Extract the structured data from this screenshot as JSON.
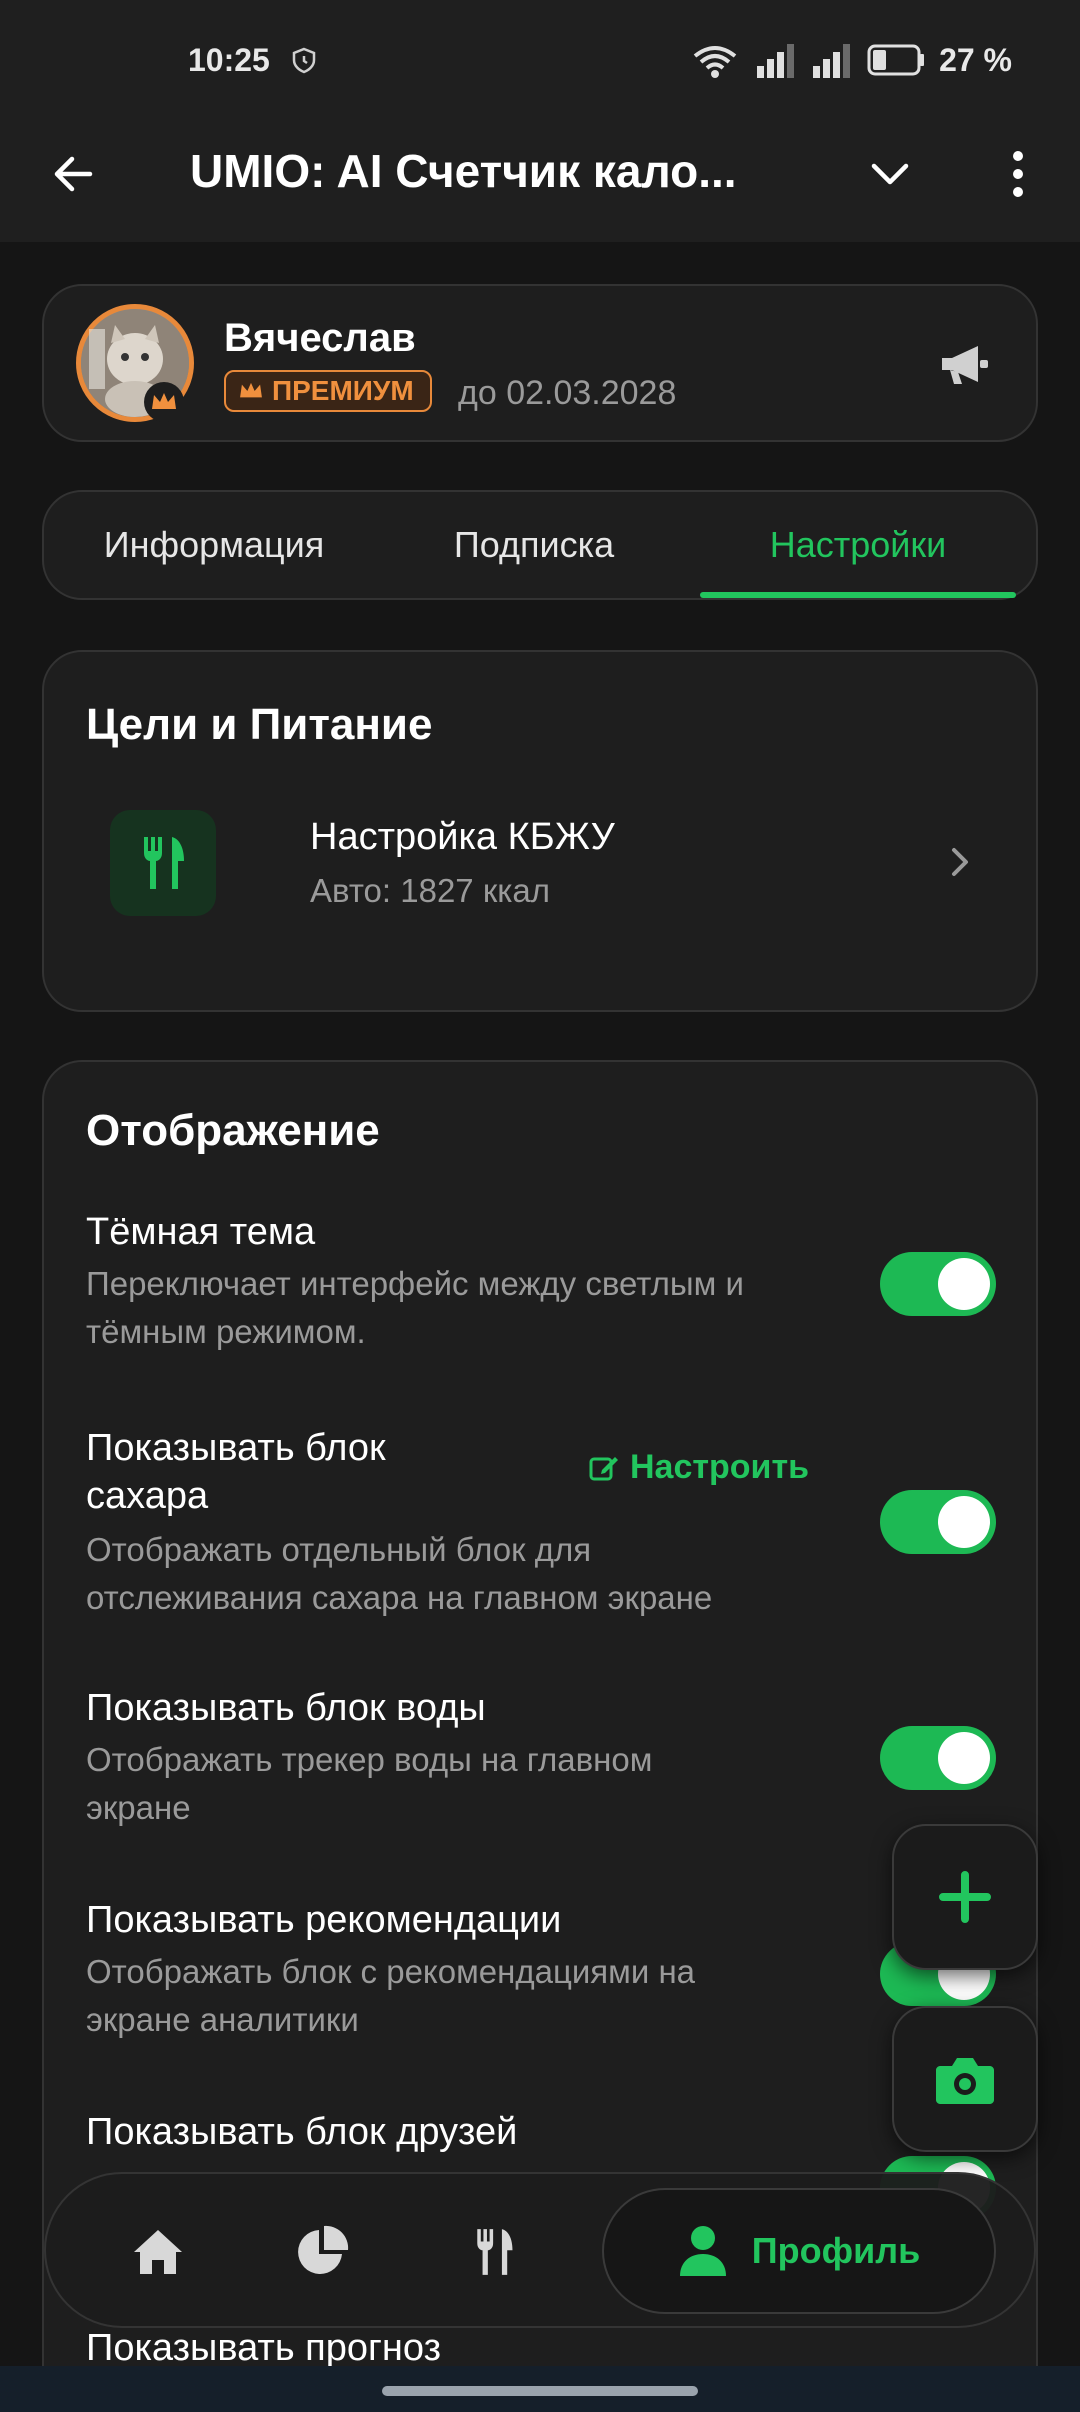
{
  "status_bar": {
    "time": "10:25",
    "battery_text": "27 %"
  },
  "app_bar": {
    "title": "UMIO: AI Счетчик кало..."
  },
  "profile": {
    "name": "Вячеслав",
    "badge": "ПРЕМИУМ",
    "until": "до 02.03.2028",
    "accent_color": "#e8893a"
  },
  "tabs": [
    {
      "label": "Информация",
      "active": false
    },
    {
      "label": "Подписка",
      "active": false
    },
    {
      "label": "Настройки",
      "active": true
    }
  ],
  "goals": {
    "title": "Цели и Питание",
    "kbju_title": "Настройка КБЖУ",
    "kbju_sub": "Авто: 1827 ккал"
  },
  "display": {
    "title": "Отображение",
    "configure_label": "Настроить",
    "settings": [
      {
        "title": "Тёмная тема",
        "desc1": "Переключает интерфейс между светлым и",
        "desc2": "тёмным режимом.",
        "on": true
      },
      {
        "title1": "Показывать блок",
        "title2": "сахара",
        "desc1": "Отображать отдельный блок для",
        "desc2": "отслеживания сахара на главном экране",
        "on": true
      },
      {
        "title": "Показывать блок воды",
        "desc1": "Отображать трекер воды на главном",
        "desc2": "экране",
        "on": true
      },
      {
        "title": "Показывать рекомендации",
        "desc1": "Отображать блок с рекомендациями на",
        "desc2": "экране аналитики",
        "on": true
      },
      {
        "title": "Показывать блок друзей",
        "on": true
      },
      {
        "title": "Показывать прогноз",
        "on": true
      }
    ]
  },
  "bottom_nav": {
    "profile_label": "Профиль",
    "items": [
      "home-icon",
      "pie-chart-icon",
      "utensils-icon",
      "user-icon"
    ]
  },
  "colors": {
    "accent_green": "#22c55e",
    "premium_orange": "#f0903e",
    "background": "#151515",
    "card": "#1e1e1e"
  }
}
